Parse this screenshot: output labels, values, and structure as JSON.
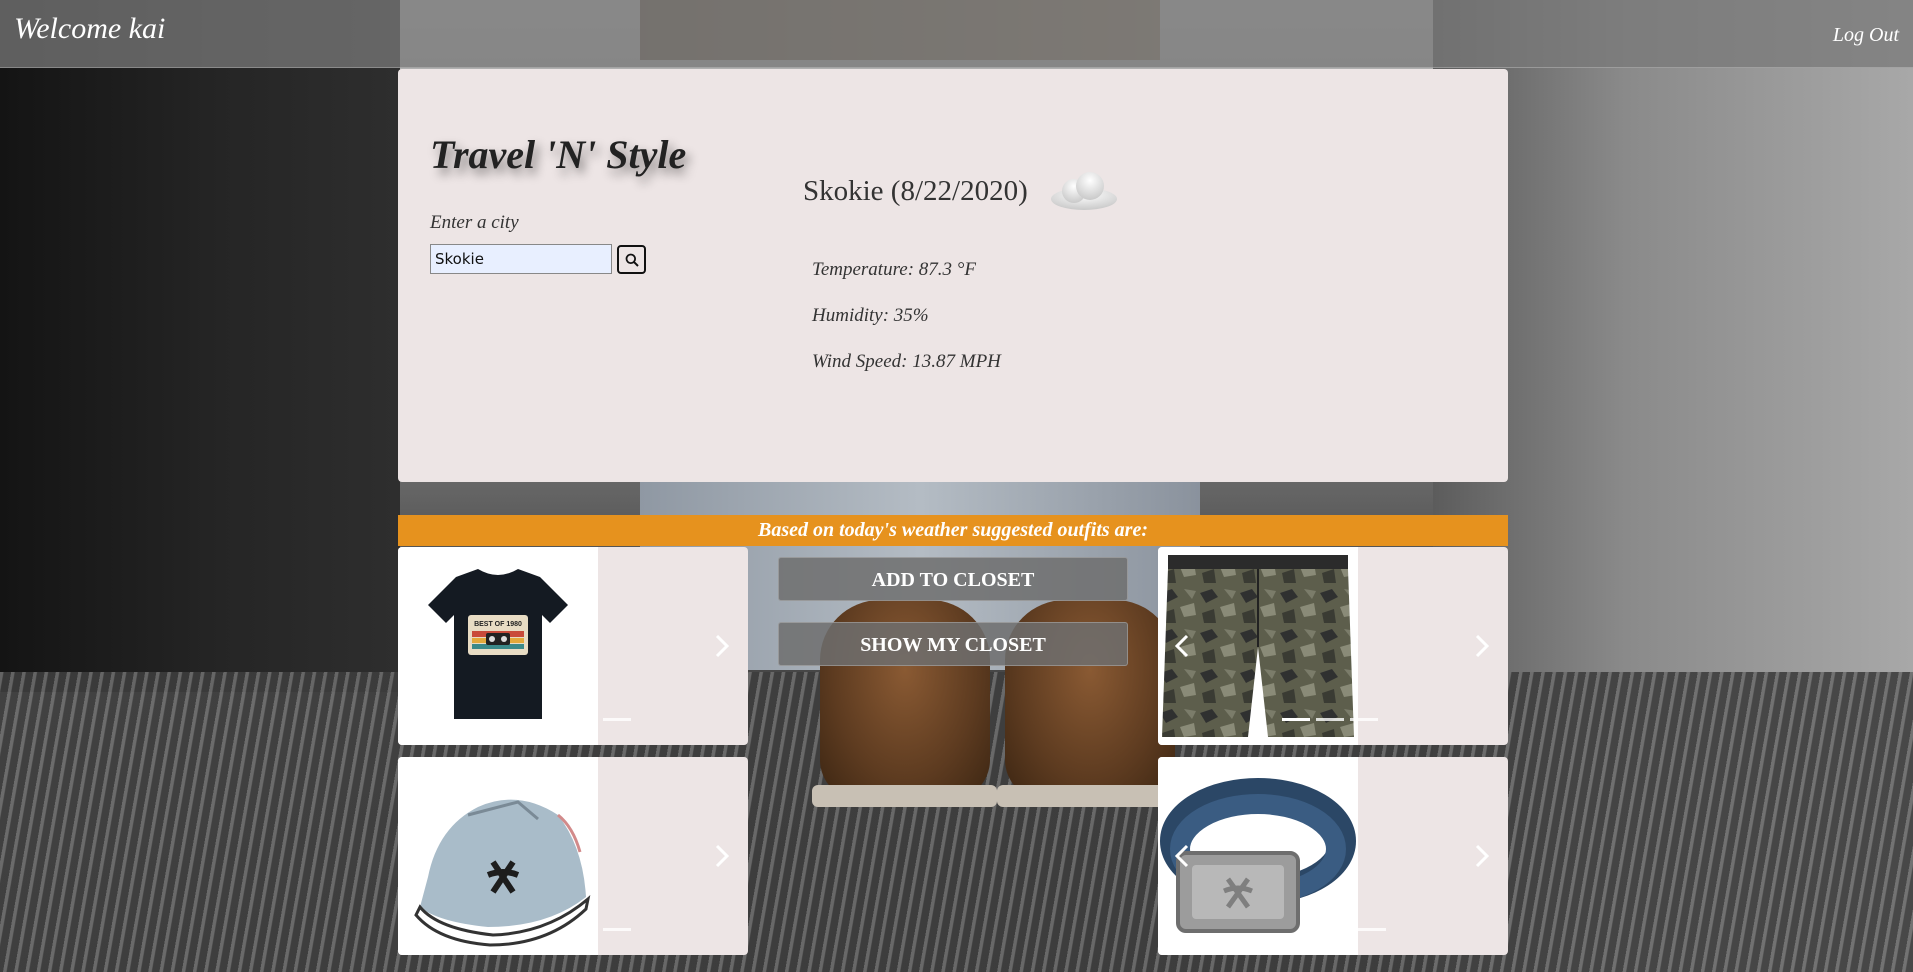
{
  "header": {
    "welcome": "Welcome kai",
    "logout": "Log Out"
  },
  "weather": {
    "app_title": "Travel 'N' Style",
    "city_label": "Enter a city",
    "city_value": "Skokie",
    "location": "Skokie (8/22/2020)",
    "condition_icon": "cloud-icon",
    "temperature": "Temperature: 87.3 °F",
    "humidity": "Humidity: 35%",
    "wind_speed": "Wind Speed: 13.87 MPH"
  },
  "suggestions": {
    "banner": "Based on today's weather suggested outfits are:",
    "items": [
      {
        "name": "t-shirt",
        "image_text": "BEST OF 1980"
      },
      {
        "name": "sneaker"
      },
      {
        "name": "camo-shorts"
      },
      {
        "name": "belt"
      }
    ]
  },
  "actions": {
    "add_to_closet": "ADD TO CLOSET",
    "show_my_closet": "SHOW MY CLOSET"
  },
  "colors": {
    "banner": "#e6921e",
    "card_bg": "#ede5e5",
    "header_bg": "#787878"
  }
}
